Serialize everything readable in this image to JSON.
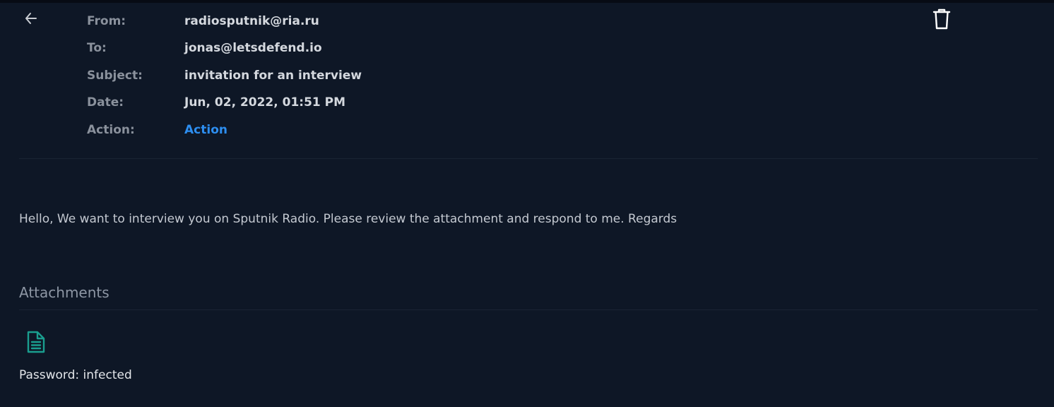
{
  "header": {
    "back_icon": "arrow-left-icon",
    "delete_icon": "trash-icon"
  },
  "meta": {
    "from_label": "From:",
    "from_value": "radiosputnik@ria.ru",
    "to_label": "To:",
    "to_value": "jonas@letsdefend.io",
    "subject_label": "Subject:",
    "subject_value": "invitation for an interview",
    "date_label": "Date:",
    "date_value": "Jun, 02, 2022, 01:51 PM",
    "action_label": "Action:",
    "action_value": "Action"
  },
  "body": {
    "text": "Hello, We want to interview you on Sputnik Radio. Please review the attachment and respond to me. Regards"
  },
  "attachments": {
    "heading": "Attachments",
    "file_icon": "file-document-icon",
    "password_text": "Password: infected"
  },
  "colors": {
    "background": "#0e1726",
    "label": "#8a919c",
    "value": "#d4d8de",
    "link": "#2d8ef0",
    "attachment_icon": "#1a9e8f"
  }
}
